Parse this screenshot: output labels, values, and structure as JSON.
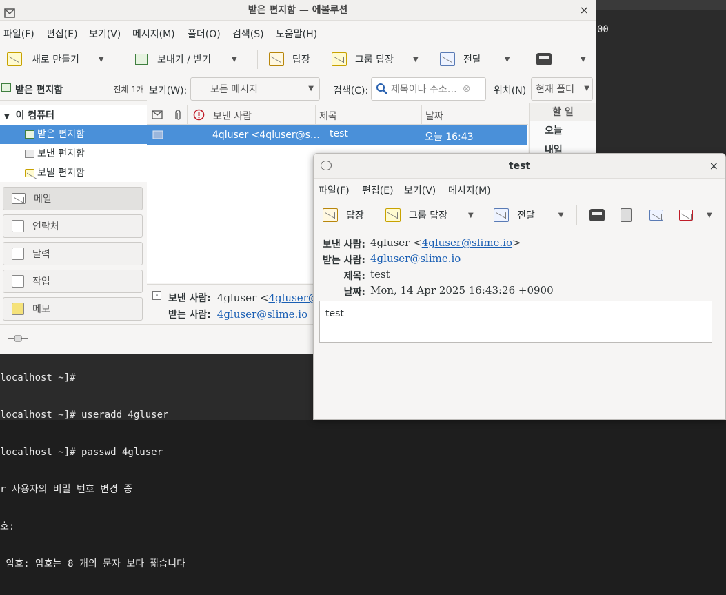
{
  "terminal": {
    "right_text": "00",
    "lines": [
      "localhost ~]#",
      "localhost ~]# useradd 4gluser",
      "localhost ~]# passwd 4gluser",
      "r 사용자의 비밀 번호 변경 중",
      "호:",
      " 암호: 암호는 8 개의 문자 보다 짧습니다"
    ]
  },
  "main_window": {
    "title": "받은 편지함 — 에볼루션",
    "close": "×",
    "menu": [
      "파일(F)",
      "편집(E)",
      "보기(V)",
      "메시지(M)",
      "폴더(O)",
      "검색(S)",
      "도움말(H)"
    ],
    "toolbar": {
      "new": "새로 만들기",
      "send_receive": "보내기 / 받기",
      "reply": "답장",
      "reply_group": "그룹 답장",
      "forward": "전달"
    },
    "folder_header": {
      "name": "받은 편지함",
      "count": "전체 1개"
    },
    "tree": {
      "root": "이 컴퓨터",
      "items": [
        "받은 편지함",
        "보낸 편지함",
        "보낼 편지함"
      ]
    },
    "nav": [
      "메일",
      "연락처",
      "달력",
      "작업",
      "메모"
    ],
    "filter": {
      "view_label": "보기(W):",
      "view_value": "모든 메시지",
      "search_label": "검색(C):",
      "search_placeholder": "제목이나 주소…",
      "scope_label": "위치(N)",
      "scope_value": "현재 폴더"
    },
    "list_headers": {
      "from": "보낸 사람",
      "subject": "제목",
      "date": "날짜"
    },
    "message": {
      "from": "4qluser <4qluser@s…",
      "subject": "test",
      "date": "오늘 16:43"
    },
    "todo": {
      "title": "할 일",
      "items": [
        "오늘",
        "내일"
      ]
    },
    "preview": {
      "from_label": "보낸 사람:",
      "from_name": "4gluser <",
      "from_email": "4gluser@sl",
      "to_label": "받는 사람:",
      "to_email": "4gluser@slime.io"
    }
  },
  "message_window": {
    "title": "test",
    "close": "×",
    "menu": [
      "파일(F)",
      "편집(E)",
      "보기(V)",
      "메시지(M)"
    ],
    "toolbar": {
      "reply": "답장",
      "reply_group": "그룹 답장",
      "forward": "전달"
    },
    "headers": {
      "from_label": "보낸 사람:",
      "from_name": "4gluser <",
      "from_email": "4gluser@slime.io",
      "from_close": ">",
      "to_label": "받는 사람:",
      "to_email": "4gluser@slime.io",
      "subject_label": "제목:",
      "subject": "test",
      "date_label": "날짜:",
      "date": "Mon, 14 Apr 2025 16:43:26 +0900"
    },
    "body": "test"
  },
  "colors": {
    "selection": "#4a90d9",
    "link": "#1a5fb4"
  }
}
